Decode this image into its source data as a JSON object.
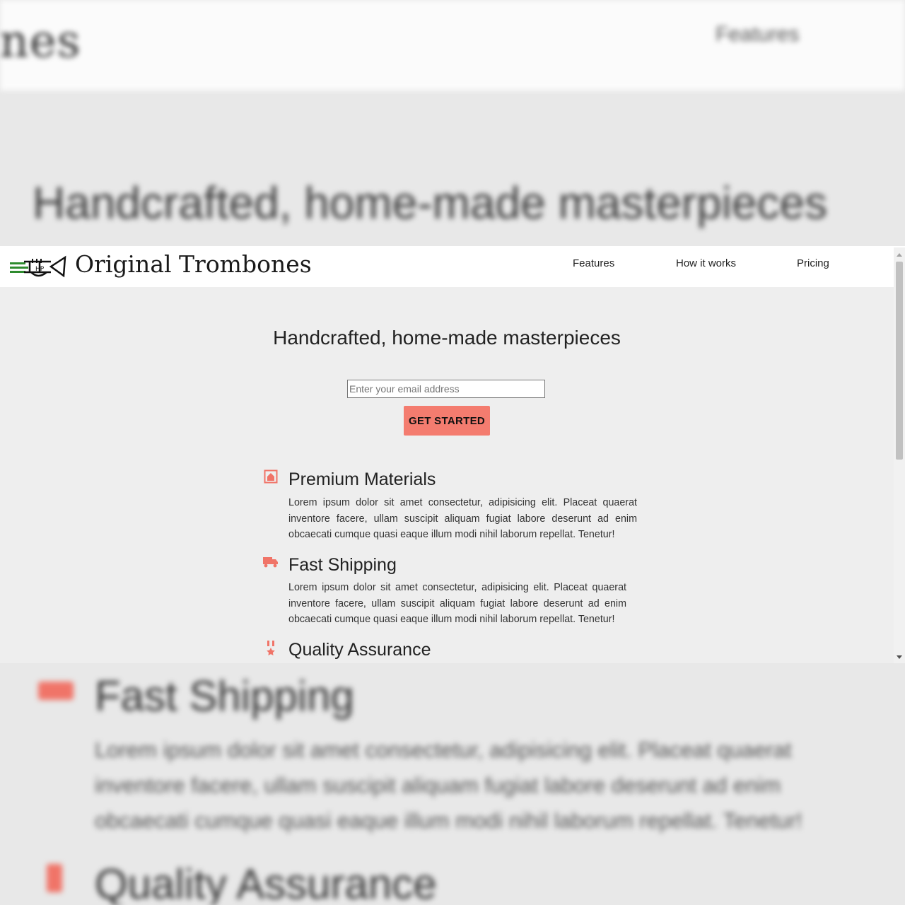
{
  "brand": {
    "name": "Original Trombones",
    "logo_icon": "trombone-logo-icon",
    "logo_accent": "#2e8b2e"
  },
  "nav": {
    "items": [
      "Features",
      "How it works",
      "Pricing"
    ]
  },
  "hero": {
    "title": "Handcrafted, home-made masterpieces",
    "email_placeholder": "Enter your email address",
    "cta_label": "GET STARTED",
    "cta_color": "#f47c6f"
  },
  "features": [
    {
      "icon": "premium-materials-icon",
      "title": "Premium Materials",
      "text": "Lorem ipsum dolor sit amet consectetur, adipisicing elit. Placeat quaerat inventore facere, ullam suscipit aliquam fugiat labore deserunt ad enim obcaecati cumque quasi eaque illum modi nihil laborum repellat. Tenetur!"
    },
    {
      "icon": "truck-icon",
      "title": "Fast Shipping",
      "text": "Lorem ipsum dolor sit amet consectetur, adipisicing elit. Placeat quaerat inventore facere, ullam suscipit aliquam fugiat labore deserunt ad enim obcaecati cumque quasi eaque illum modi nihil laborum repellat. Tenetur!"
    },
    {
      "icon": "medal-icon",
      "title": "Quality Assurance",
      "text": ""
    }
  ],
  "background": {
    "logo_fragment": "ones",
    "nav_fragment": "Features",
    "title": "Handcrafted, home-made masterpieces",
    "ship_title": "Fast Shipping",
    "ship_text": "Lorem ipsum dolor sit amet consectetur, adipisicing elit. Placeat quaerat inventore facere, ullam suscipit aliquam fugiat labore deserunt ad enim obcaecati cumque quasi eaque illum modi nihil laborum repellat. Tenetur!",
    "qa_title": "Quality Assurance"
  },
  "colors": {
    "accent": "#f47c6f",
    "page_bg": "#eeeeee",
    "header_bg": "#ffffff"
  }
}
